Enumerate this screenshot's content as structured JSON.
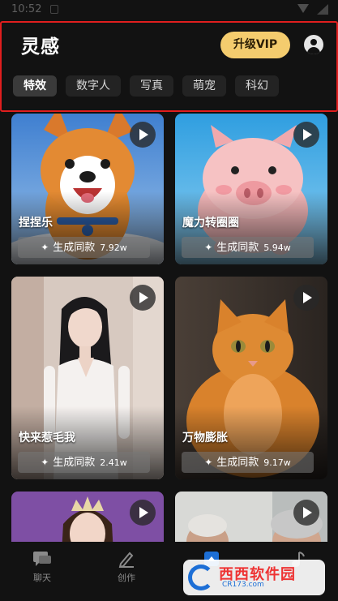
{
  "status_bar": {
    "time": "10:52"
  },
  "header": {
    "title": "灵感",
    "vip_label": "升级VIP"
  },
  "tabs": [
    {
      "label": "特效",
      "active": true
    },
    {
      "label": "数字人",
      "active": false
    },
    {
      "label": "写真",
      "active": false
    },
    {
      "label": "萌宠",
      "active": false
    },
    {
      "label": "科幻",
      "active": false
    }
  ],
  "cards": [
    {
      "title": "捏捏乐",
      "action": "生成同款",
      "count": "7.92w"
    },
    {
      "title": "魔力转圈圈",
      "action": "生成同款",
      "count": "5.94w"
    },
    {
      "title": "快来惹毛我",
      "action": "生成同款",
      "count": "2.41w"
    },
    {
      "title": "万物膨胀",
      "action": "生成同款",
      "count": "9.17w"
    },
    {
      "title": "",
      "action": "",
      "count": ""
    },
    {
      "title": "",
      "action": "",
      "count": ""
    }
  ],
  "bottom_nav": [
    {
      "label": "聊天",
      "icon": "chat-icon"
    },
    {
      "label": "创作",
      "icon": "pencil-icon"
    },
    {
      "label": "",
      "icon": "inspiration-icon",
      "active": true
    },
    {
      "label": "",
      "icon": "music-icon"
    }
  ],
  "watermark": {
    "brand": "西西软件园",
    "url": "CR173.com"
  },
  "colors": {
    "accent_gold": "#f4cc6e",
    "highlight_border": "#e01e1e",
    "background": "#121212"
  }
}
